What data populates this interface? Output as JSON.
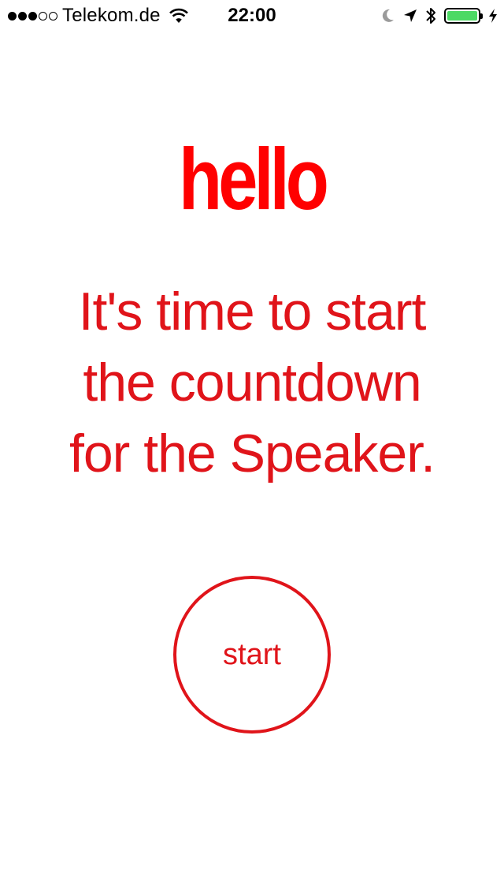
{
  "status_bar": {
    "carrier": "Telekom.de",
    "time": "22:00",
    "signal_dots_filled": 3,
    "signal_dots_total": 5,
    "battery_level": 1.0,
    "icons": [
      "wifi-icon",
      "moon-icon",
      "location-arrow-icon",
      "bluetooth-icon",
      "battery-icon",
      "charging-bolt-icon"
    ]
  },
  "main": {
    "greeting": "hello",
    "message_lines": [
      "It's time to start",
      "the countdown",
      "for the Speaker."
    ],
    "start_label": "start"
  },
  "colors": {
    "accent": "#e0141a",
    "greeting": "#ff0000",
    "battery_fill": "#4cd964",
    "background": "#ffffff"
  }
}
